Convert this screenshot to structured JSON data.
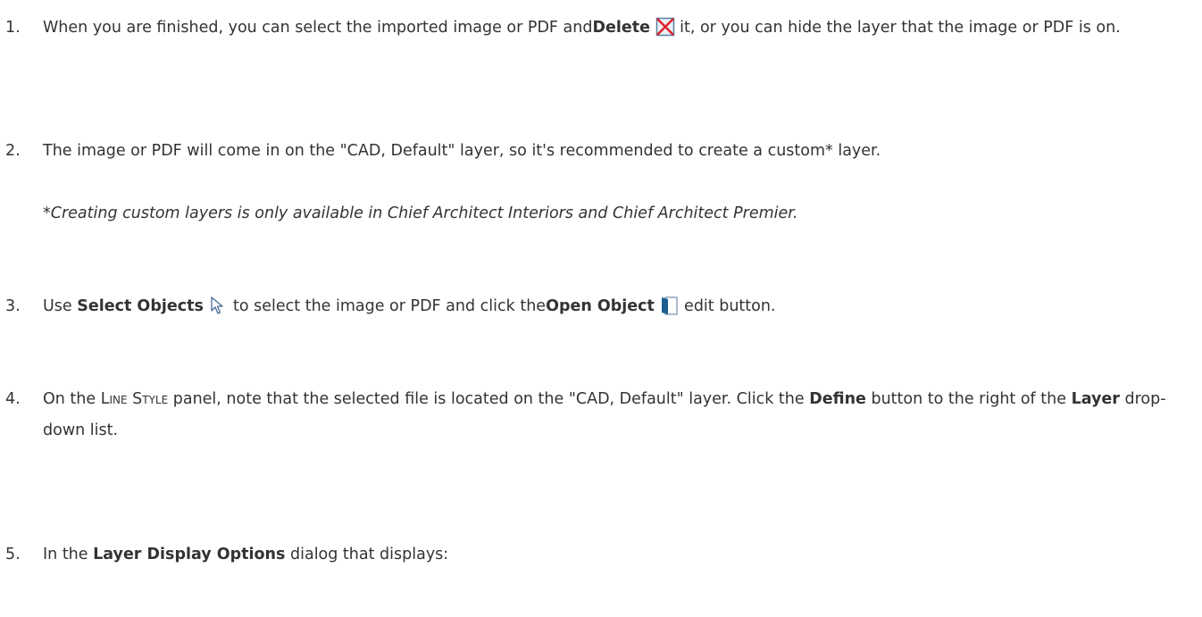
{
  "steps": [
    {
      "number": "1.",
      "text_before": "When you are finished, you can select the imported image or PDF and",
      "bold": "Delete",
      "icon": "delete-icon",
      "text_after": " it, or you can hide the layer that the image or PDF is on."
    },
    {
      "number": "2.",
      "text": "The image or PDF will come in on the \"CAD, Default\" layer, so it's recommended to create a custom* layer.",
      "note": "*Creating custom layers is only available in Chief Architect Interiors and Chief Architect Premier."
    },
    {
      "number": "3.",
      "text_a": "Use ",
      "bold_a": "Select Objects",
      "icon_a": "select-objects-icon",
      "text_b": " to select the image or PDF and click the",
      "bold_b": "Open Object",
      "icon_b": "open-object-icon",
      "text_c": " edit button."
    },
    {
      "number": "4.",
      "text_a": "On the ",
      "smallcaps": "Line Style",
      "text_b": " panel, note that the selected file is located on the \"CAD, Default\" layer. Click the ",
      "bold_a": "Define",
      "text_c": " button to the right of the ",
      "bold_b": "Layer",
      "text_d": " drop-down list."
    },
    {
      "number": "5.",
      "text_a": "In the ",
      "bold": "Layer Display Options",
      "text_b": " dialog that displays:"
    }
  ]
}
